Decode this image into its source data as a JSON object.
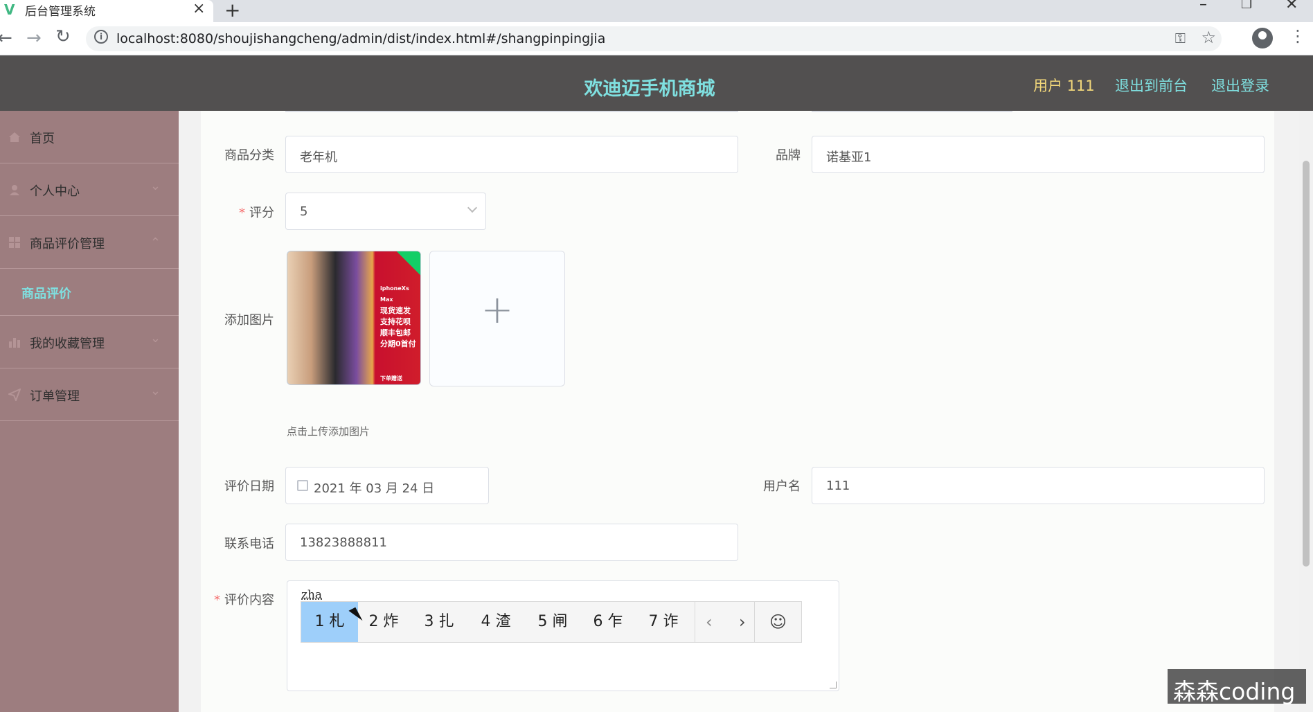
{
  "browser": {
    "tab_title": "后台管理系统",
    "url": "localhost:8080/shoujishangcheng/admin/dist/index.html#/shangpinpingjia"
  },
  "header": {
    "brand": "欢迪迈手机商城",
    "user_label": "用户 111",
    "front_link": "退出到前台",
    "logout_link": "退出登录"
  },
  "sidebar": {
    "items": [
      {
        "label": "首页",
        "icon": "home-icon"
      },
      {
        "label": "个人中心",
        "icon": "user-icon"
      },
      {
        "label": "商品评价管理",
        "icon": "grid-icon"
      },
      {
        "label": "我的收藏管理",
        "icon": "chart-icon"
      },
      {
        "label": "订单管理",
        "icon": "send-icon"
      }
    ],
    "active_sub": "商品评价",
    "accent": "#7fe0e0"
  },
  "form": {
    "category": {
      "label": "商品分类",
      "value": "老年机"
    },
    "brand": {
      "label": "品牌",
      "value": "诺基亚1"
    },
    "rating": {
      "label": "评分",
      "value": "5",
      "required": true
    },
    "image": {
      "label": "添加图片",
      "tip": "点击上传添加图片",
      "thumb_text": [
        "iphoneXs Max",
        "现货速发",
        "支持花呗",
        "顺丰包邮",
        "分期0首付",
        "下单赠送"
      ]
    },
    "date": {
      "label": "评价日期",
      "value": "2021 年 03 月 24 日"
    },
    "username": {
      "label": "用户名",
      "value": "111"
    },
    "phone": {
      "label": "联系电话",
      "value": "13823888811"
    },
    "content": {
      "label": "评价内容",
      "required": true,
      "composition": "zha"
    }
  },
  "ime": {
    "candidates": [
      "1 札",
      "2 炸",
      "3 扎",
      "4 渣",
      "5 闸",
      "6 乍",
      "7 诈"
    ],
    "selected_index": 0,
    "prev": "‹",
    "next": "›",
    "emoji": "☺"
  },
  "watermark": "森森coding"
}
